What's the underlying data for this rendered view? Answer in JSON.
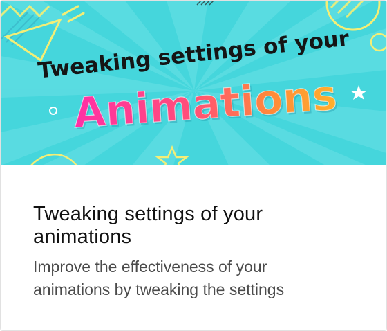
{
  "banner": {
    "headline": "Tweaking settings of your",
    "word": "Animations",
    "colors": {
      "background": "#45d6dc",
      "ray": "#63e0e5",
      "headline": "#151515",
      "gradient_start": "#ff2fa6",
      "gradient_mid": "#ff5a5f",
      "gradient_end": "#ffb12b",
      "accent_shape": "#f4ee76"
    }
  },
  "card": {
    "title": "Tweaking settings of your animations",
    "description": "Improve the effectiveness of your animations by tweaking the settings"
  }
}
